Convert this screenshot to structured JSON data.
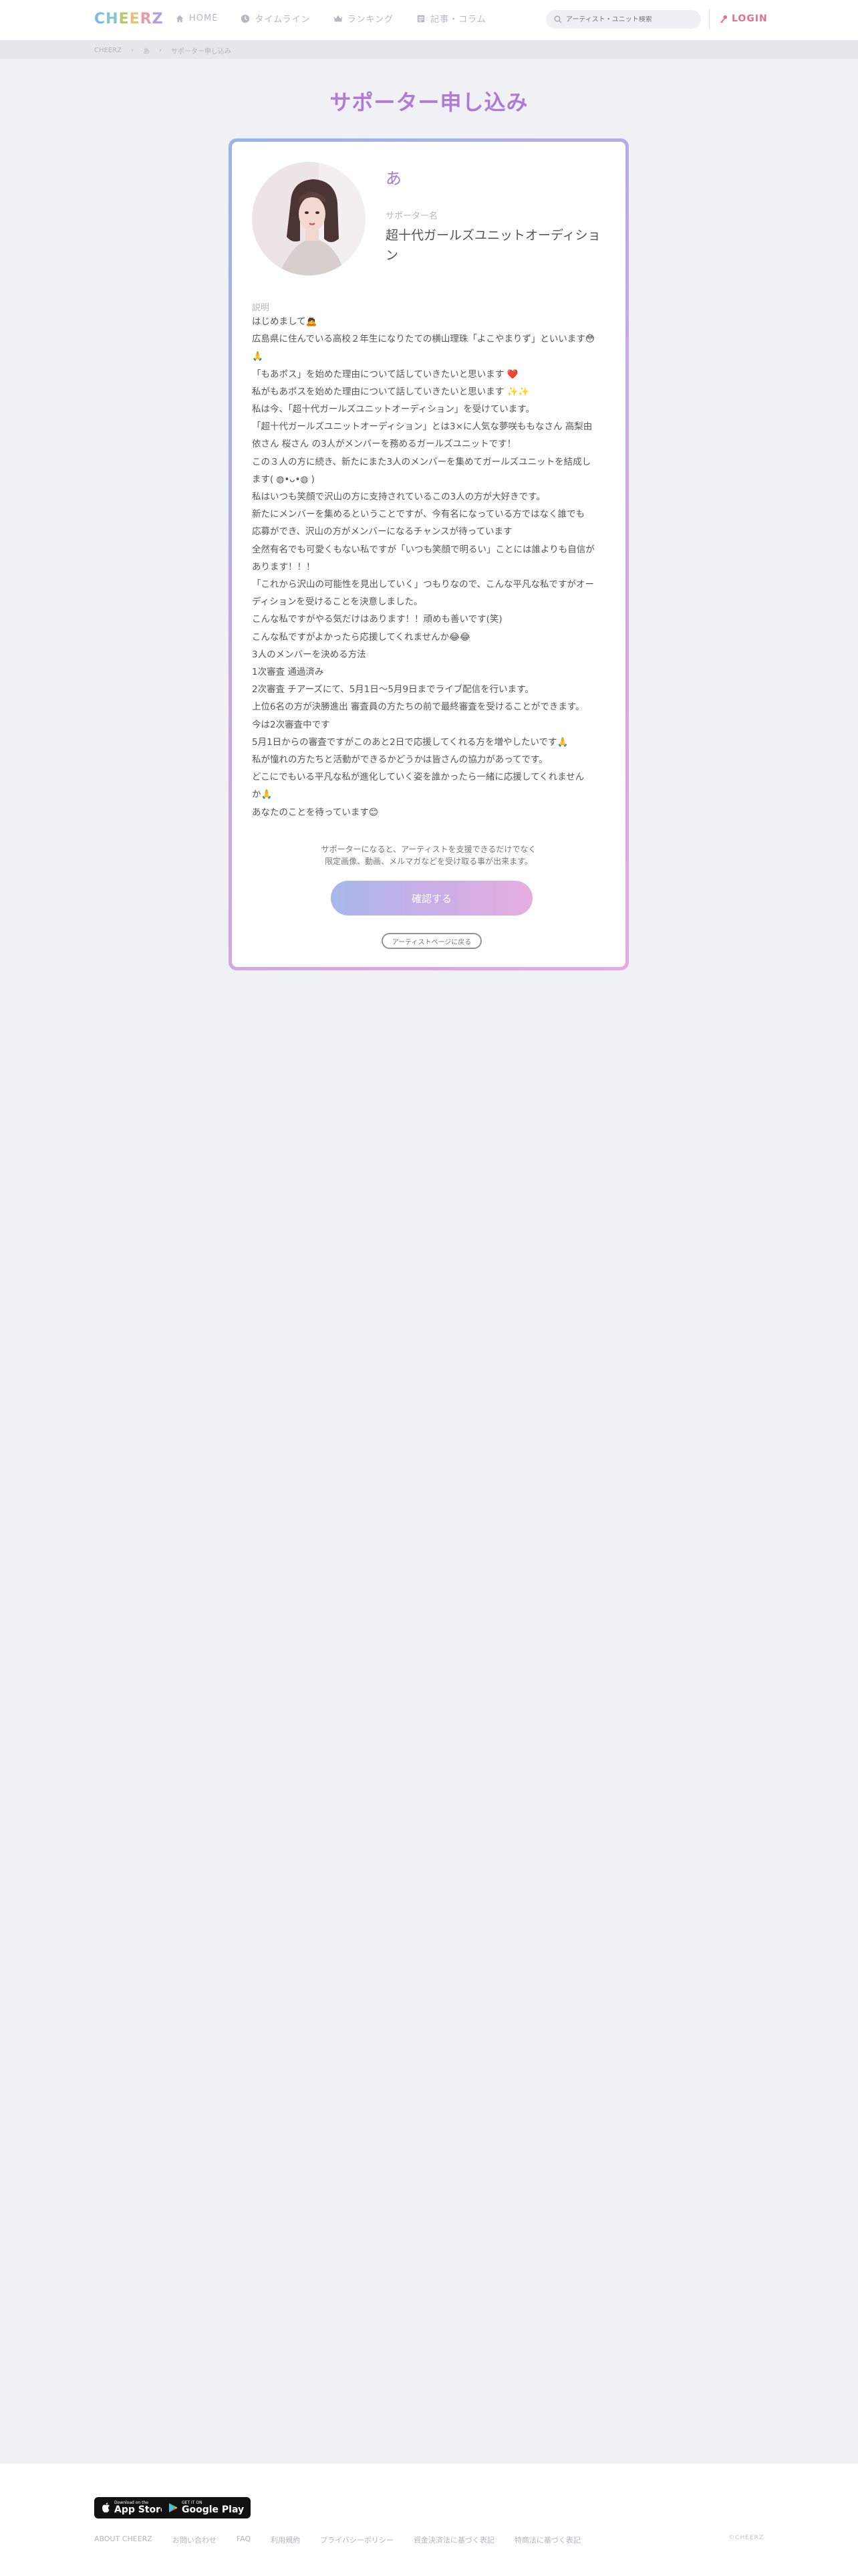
{
  "header": {
    "logo_letters": [
      "C",
      "H",
      "E",
      "E",
      "R",
      "Z"
    ],
    "logo_colors": [
      "#7fb8e6",
      "#7fc9c6",
      "#b6c96f",
      "#e8c27a",
      "#e89aa8",
      "#b899dc"
    ],
    "nav": [
      {
        "label": "HOME",
        "icon": "home-icon"
      },
      {
        "label": "タイムライン",
        "icon": "clock-icon"
      },
      {
        "label": "ランキング",
        "icon": "crown-icon"
      },
      {
        "label": "記事・コラム",
        "icon": "article-icon"
      }
    ],
    "search_placeholder": "アーティスト・ユニット検索",
    "login_label": "LOGIN"
  },
  "breadcrumb": [
    "CHEERZ",
    "あ",
    "サポーター申し込み"
  ],
  "page_title": "サポーター申し込み",
  "artist": {
    "name": "あ",
    "supporter_label": "サポーター名",
    "supporter_name": "超十代ガールズユニットオーディション"
  },
  "description": {
    "label": "説明",
    "lines": [
      "はじめまして🙇",
      "広島県に住んでいる高校２年生になりたての横山理珠「よこやまりず」といいます😳",
      "🙏",
      "「もあポス」を始めた理由について話していきたいと思います ❤️️",
      "私がもあポスを始めた理由について話していきたいと思います ✨✨",
      "私は今、「超十代ガールズユニットオーディション」を受けています。",
      "「超十代ガールズユニットオーディション」とは3×に人気な夢咲ももなさん 高梨由",
      "依さん 桜さん の3人がメンバーを務めるガールズユニットです！",
      "この３人の方に続き、新たにまた3人のメンバーを集めてガールズユニットを結成し",
      "ます( ◍•ᴗ•◍ )",
      "私はいつも笑顔で沢山の方に支持されているこの3人の方が大好きです。",
      "新たにメンバーを集めるということですが、今有名になっている方ではなく誰でも",
      "応募ができ、沢山の方がメンバーになるチャンスが待っています",
      "全然有名でも可愛くもない私ですが「いつも笑顔で明るい」ことには誰よりも自信が",
      "あります！！！",
      "「これから沢山の可能性を見出していく」つもりなので、こんな平凡な私ですがオー",
      "ディションを受けることを決意しました。",
      "こんな私ですがやる気だけはあります！！頑めも善いです(笑)",
      "こんな私ですがよかったら応援してくれませんか😂😂",
      "3人のメンバーを決める方法",
      "1次審査 通過済み",
      "2次審査 チアーズにて、5月1日〜5月9日までライブ配信を行います。",
      "上位6名の方が決勝進出 審査員の方たちの前で最終審査を受けることができます。",
      "今は2次審査中です",
      "5月1日からの審査ですがこのあと2日で応援してくれる方を増やしたいです🙏",
      "私が憧れの方たちと活動ができるかどうかは皆さんの協力があってです。",
      "どこにでもいる平凡な私が進化していく姿を誰かったら一緒に応援してくれません",
      "か🙏",
      "あなたのことを待っています😊"
    ]
  },
  "notice": [
    "サポーターになると、アーティストを支援できるだけでなく",
    "限定画像、動画、メルマガなどを受け取る事が出来ます。"
  ],
  "confirm_label": "確認する",
  "back_label": "アーティストページに戻る",
  "footer": {
    "app_store": {
      "small": "Download on the",
      "big": "App Store"
    },
    "google_play": {
      "small": "GET IT ON",
      "big": "Google Play"
    },
    "links": [
      "ABOUT CHEERZ",
      "お問い合わせ",
      "FAQ",
      "利用規約",
      "プライバシーポリシー",
      "資金決済法に基づく表記",
      "特商法に基づく表記"
    ],
    "copyright": "©CHEERZ"
  }
}
